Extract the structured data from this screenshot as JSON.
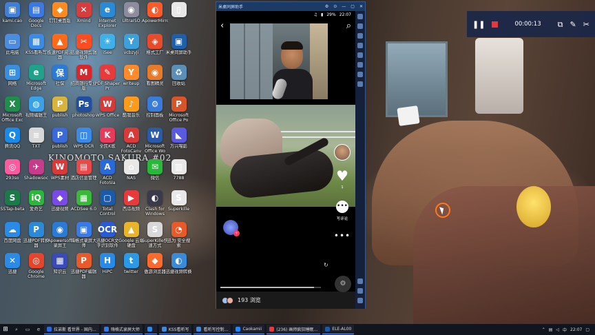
{
  "desktop": {
    "sakura_text": "KINOMOTO SAKURA #02",
    "icons": [
      {
        "label": "kami.cao",
        "glyph": "▣",
        "color": "#3f7fd8"
      },
      {
        "label": "Google Docs",
        "glyph": "▤",
        "color": "#3b78e7"
      },
      {
        "label": "钉钉桌面版",
        "glyph": "◆",
        "color": "#ff8a1f"
      },
      {
        "label": "Xmind",
        "glyph": "✕",
        "color": "#d93c3c"
      },
      {
        "label": "Internet Explorer",
        "glyph": "e",
        "color": "#2b8ad8"
      },
      {
        "label": "UltraISO",
        "glyph": "◉",
        "color": "#8c8c9c"
      },
      {
        "label": "ApowerMirror",
        "glyph": "◐",
        "color": "#ff5a2a"
      },
      {
        "label": "",
        "glyph": "▯",
        "color": "#e8e8e8"
      },
      {
        "label": "此电脑",
        "glyph": "▭",
        "color": "#4b8be0"
      },
      {
        "label": "KSS看听写",
        "glyph": "▦",
        "color": "#3a8be8"
      },
      {
        "label": "极速PDF阅读器",
        "glyph": "▲",
        "color": "#ff6a1a"
      },
      {
        "label": "迅捷视频剪辑软件",
        "glyph": "✂",
        "color": "#ff4c1f"
      },
      {
        "label": "iSee",
        "glyph": "☀",
        "color": "#3fb0e8"
      },
      {
        "label": "vcbzyJi",
        "glyph": "Y",
        "color": "#3da0d8"
      },
      {
        "label": "格式工厂",
        "glyph": "◈",
        "color": "#e84a2a"
      },
      {
        "label": "米桌同屏助手",
        "glyph": "▣",
        "color": "#1f5fa8"
      },
      {
        "label": "网络",
        "glyph": "⊞",
        "color": "#3a8ee0"
      },
      {
        "label": "Microsoft Edge",
        "glyph": "e",
        "color": "#1fa18a"
      },
      {
        "label": "社保",
        "glyph": "保",
        "color": "#2a7ad8"
      },
      {
        "label": "招商银行专业版",
        "glyph": "M",
        "color": "#d8262a"
      },
      {
        "label": "PDF Shaper Pr",
        "glyph": "✎",
        "color": "#e83a3a"
      },
      {
        "label": "writeup",
        "glyph": "Y",
        "color": "#ff8a2a"
      },
      {
        "label": "看图精灵",
        "glyph": "◉",
        "color": "#e87a2a"
      },
      {
        "label": "回收站",
        "glyph": "♻",
        "color": "#5a90b8"
      },
      {
        "label": "Microsoft Office Exc",
        "glyph": "X",
        "color": "#1e8e4a"
      },
      {
        "label": "视频编辑王",
        "glyph": "◍",
        "color": "#3aa0e8"
      },
      {
        "label": "publish",
        "glyph": "P",
        "color": "#d8b43a"
      },
      {
        "label": "photoshop",
        "glyph": "Ps",
        "color": "#1f4fa0"
      },
      {
        "label": "WPS Office",
        "glyph": "W",
        "color": "#d83a3a"
      },
      {
        "label": "酷我音乐",
        "glyph": "♪",
        "color": "#ff9a1a"
      },
      {
        "label": "控制面板",
        "glyph": "⚙",
        "color": "#3a7ad8"
      },
      {
        "label": "Microsoft Office Po",
        "glyph": "P",
        "color": "#d8552a"
      },
      {
        "label": "腾讯QQ",
        "glyph": "Q",
        "color": "#1a8ae8"
      },
      {
        "label": "TXT",
        "glyph": "≡",
        "color": "#d8d8d8"
      },
      {
        "label": "publish",
        "glyph": "P",
        "color": "#3a6ad8"
      },
      {
        "label": "WPS OCR",
        "glyph": "◫",
        "color": "#3a8ae8"
      },
      {
        "label": "全民K歌",
        "glyph": "K",
        "color": "#e83a5a"
      },
      {
        "label": "ACD FotoCanv",
        "glyph": "A",
        "color": "#d83a3a"
      },
      {
        "label": "Microsoft Office Wo",
        "glyph": "W",
        "color": "#2a5aa8"
      },
      {
        "label": "万兴喵影",
        "glyph": "◣",
        "color": "#5a5ae0"
      },
      {
        "label": "293so",
        "glyph": "◎",
        "color": "#ff5aa0"
      },
      {
        "label": "Shadowsoc",
        "glyph": "✈",
        "color": "#c83a8a"
      },
      {
        "label": "WPS素材",
        "glyph": "W",
        "color": "#d83a3a"
      },
      {
        "label": "酒店信息管理",
        "glyph": "▤",
        "color": "#e84a4a"
      },
      {
        "label": "ACD FotoSla",
        "glyph": "A",
        "color": "#2a6ad8"
      },
      {
        "label": "NAS",
        "glyph": "⌂",
        "color": "#e8e8e8"
      },
      {
        "label": "微信",
        "glyph": "✉",
        "color": "#2ab83a"
      },
      {
        "label": "7788",
        "glyph": "▥",
        "color": "#e8e8e8"
      },
      {
        "label": "SSTap-beta",
        "glyph": "S",
        "color": "#1a7a4a"
      },
      {
        "label": "爱奇艺",
        "glyph": "iQ",
        "color": "#2ab83a"
      },
      {
        "label": "迅捷视频",
        "glyph": "◆",
        "color": "#7a4ae8"
      },
      {
        "label": "ACDSee 6.0",
        "glyph": "▦",
        "color": "#3ab83a"
      },
      {
        "label": "Total Control",
        "glyph": "▢",
        "color": "#1a5aa8"
      },
      {
        "label": "西瓜视频",
        "glyph": "▶",
        "color": "#e83a3a"
      },
      {
        "label": "Clash for Windows",
        "glyph": "◐",
        "color": "#3a3a4a"
      },
      {
        "label": "Superkille",
        "glyph": "S",
        "color": "#e8e8e8"
      },
      {
        "label": "百度网盘",
        "glyph": "☁",
        "color": "#2a8ae8"
      },
      {
        "label": "迅捷PDF转换器",
        "glyph": "P",
        "color": "#2a8ad8"
      },
      {
        "label": "Apowersoft录屏王",
        "glyph": "◉",
        "color": "#2a7ad8"
      },
      {
        "label": "嗨格式录屏大师",
        "glyph": "▣",
        "color": "#3a7ae8"
      },
      {
        "label": "迅捷OCR文字识别软件",
        "glyph": "OCR",
        "color": "#2a5ad8"
      },
      {
        "label": "Google 云端硬盘",
        "glyph": "▲",
        "color": "#e8b42a"
      },
      {
        "label": "SuperKille快速方式",
        "glyph": "S",
        "color": "#d8d8d8"
      },
      {
        "label": "迅为 安全搜索",
        "glyph": "◔",
        "color": "#e85a2a"
      },
      {
        "label": "迅捷",
        "glyph": "✕",
        "color": "#2a8ae8"
      },
      {
        "label": "Google Chrome",
        "glyph": "◎",
        "color": "#e8442a"
      },
      {
        "label": "知识云",
        "glyph": "▦",
        "color": "#3a4ab8"
      },
      {
        "label": "迅捷PDF编辑器",
        "glyph": "P",
        "color": "#e85a2a"
      },
      {
        "label": "HiPC",
        "glyph": "H",
        "color": "#2a8ae8"
      },
      {
        "label": "twitter",
        "glyph": "t",
        "color": "#2a9ae8"
      },
      {
        "label": "傲游浏览器",
        "glyph": "◆",
        "color": "#ff6a2a"
      },
      {
        "label": "迅捷视频转换",
        "glyph": "◐",
        "color": "#3a8ad8"
      }
    ]
  },
  "mirror": {
    "title": "米桌同屏助手",
    "status_time": "22:07",
    "battery": "29%",
    "likes_label": "1",
    "comment_label": "写评论",
    "views_text": "193 浏览",
    "progress": 0.93
  },
  "recorder": {
    "time": "00:00:13"
  },
  "taskbar": {
    "clock": "22:07",
    "tasks": [
      {
        "label": "拉弟斯 看世界 - 国内…",
        "color": "#2a6ae8"
      },
      {
        "label": "嗨格式录屏大师",
        "color": "#3a7ae8"
      },
      {
        "label": "",
        "color": "#2a8ae8"
      },
      {
        "label": "KSS看听写",
        "color": "#3a8be8"
      },
      {
        "label": "看听写控制…",
        "color": "#3a8be8"
      },
      {
        "label": "Caokamii",
        "color": "#1f8aff"
      },
      {
        "label": "(236) 画师疯狂睡眠…",
        "color": "#e83a3a"
      },
      {
        "label": "ELE-AL00",
        "color": "#1a5aa8"
      }
    ]
  }
}
